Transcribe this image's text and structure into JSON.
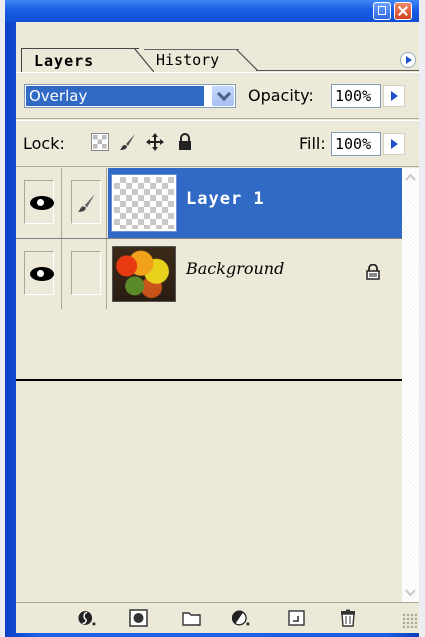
{
  "window": {
    "controls": [
      "minimize",
      "close"
    ]
  },
  "tabs": [
    {
      "label": "Layers",
      "active": true
    },
    {
      "label": "History",
      "active": false
    }
  ],
  "blend": {
    "mode": "Overlay",
    "opacity_label": "Opacity:",
    "opacity_value": "100%"
  },
  "lock": {
    "label": "Lock:",
    "icons": [
      "lock-transparency-icon",
      "lock-image-brush-icon",
      "lock-position-move-icon",
      "lock-all-padlock-icon"
    ],
    "fill_label": "Fill:",
    "fill_value": "100%"
  },
  "layers": [
    {
      "name": "Layer 1",
      "visible": true,
      "selected": true,
      "linked_icon": "brush-icon",
      "locked": false
    },
    {
      "name": "Background",
      "visible": true,
      "selected": false,
      "locked": true
    }
  ],
  "bottom_toolbar": {
    "icons": [
      "add-layer-style-icon",
      "add-mask-icon",
      "new-group-folder-icon",
      "new-adjustment-layer-icon",
      "new-layer-icon",
      "delete-layer-trash-icon"
    ]
  },
  "colors": {
    "frame_blue": "#1a5de6",
    "selection": "#316ac5",
    "panel_bg": "#ece9d8"
  }
}
